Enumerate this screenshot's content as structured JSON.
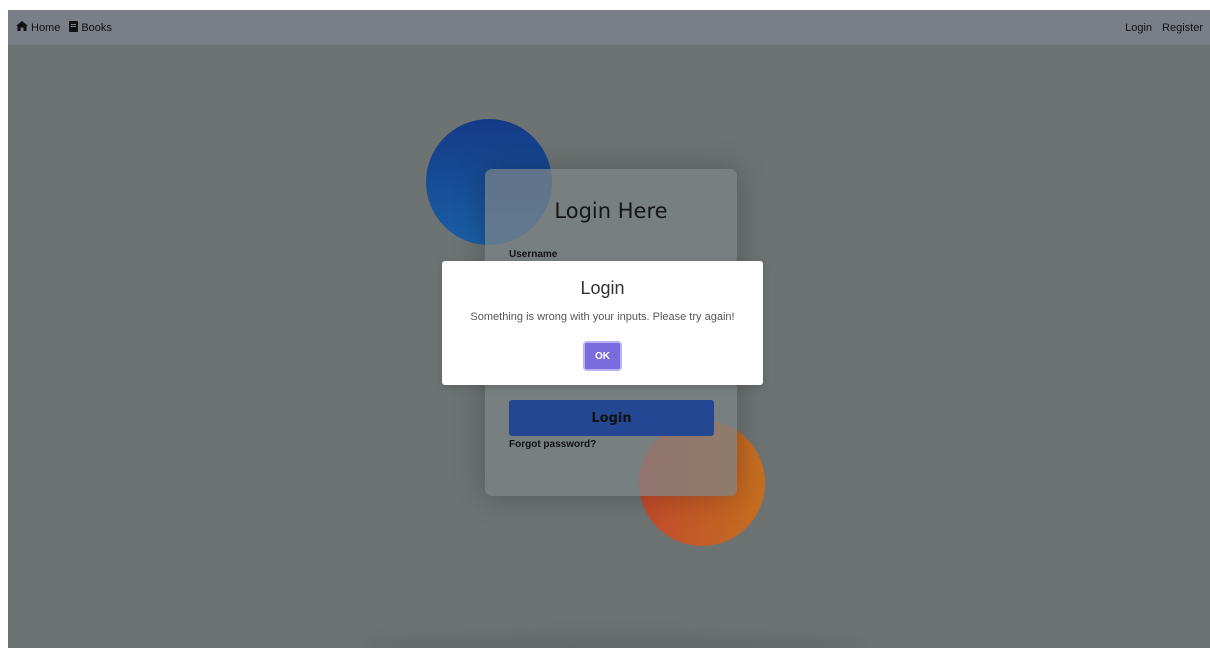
{
  "navbar": {
    "left_items": [
      {
        "label": "Home",
        "icon": "home-icon"
      },
      {
        "label": "Books",
        "icon": "book-icon"
      }
    ],
    "right_items": [
      {
        "label": "Login"
      },
      {
        "label": "Register"
      }
    ]
  },
  "login_form": {
    "title": "Login Here",
    "username_label": "Username",
    "username_value": "",
    "submit_label": "Login",
    "forgot_link": "Forgot password?"
  },
  "modal": {
    "title": "Login",
    "message": "Something is wrong with your inputs. Please try again!",
    "ok_label": "OK"
  },
  "colors": {
    "overlay_background": "#6d7373",
    "navbar_background": "#7a7e87",
    "login_button": "#244793",
    "ok_button": "#7a6bde",
    "circle_blue": "#1a4f98",
    "circle_orange": "#c45a26"
  }
}
